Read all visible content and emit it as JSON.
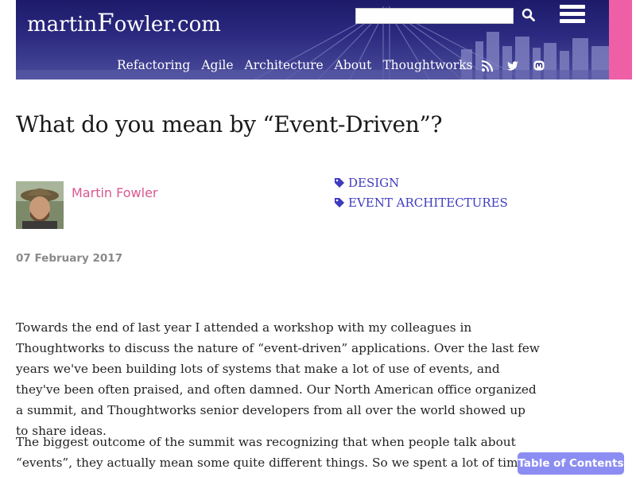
{
  "site": {
    "logo_prefix": "martin",
    "logo_big": "F",
    "logo_suffix": "owler.com"
  },
  "search": {
    "placeholder": ""
  },
  "nav": {
    "items": [
      "Refactoring",
      "Agile",
      "Architecture",
      "About",
      "Thoughtworks"
    ]
  },
  "social": [
    "rss-icon",
    "twitter-icon",
    "mastodon-icon"
  ],
  "article": {
    "title": "What do you mean by “Event-Driven”?",
    "author": "Martin Fowler",
    "date": "07 February 2017",
    "tags": [
      "DESIGN",
      "EVENT ARCHITECTURES"
    ],
    "paragraphs": [
      "Towards the end of last year I attended a workshop with my colleagues in Thoughtworks to discuss the nature of “event-driven” applications. Over the last few years we've been building lots of systems that make a lot of use of events, and they've been often praised, and often damned. Our North American office organized a summit, and Thoughtworks senior developers from all over the world showed up to share ideas.",
      "The biggest outcome of the summit was recognizing that when people talk about “events”, they actually mean some quite different things. So we spent a lot of time"
    ]
  },
  "toc": {
    "label": "Table of Contents"
  },
  "colors": {
    "banner": "#2b2a80",
    "pink": "#ee5fa6",
    "author": "#d9578f",
    "tag": "#3f3bbf",
    "toc": "#8c8df2"
  }
}
